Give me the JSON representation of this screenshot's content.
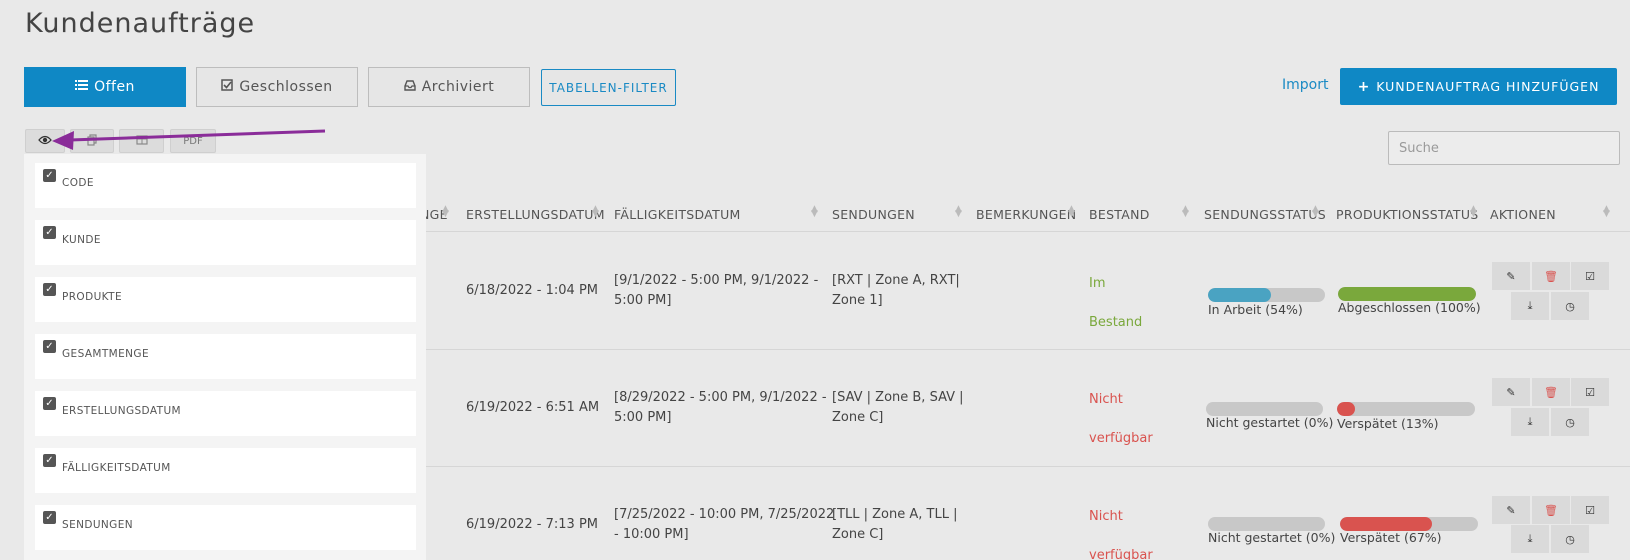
{
  "page": {
    "title": "Kundenaufträge"
  },
  "tabs": [
    {
      "label": "Offen",
      "icon": "list-icon",
      "active": true
    },
    {
      "label": "Geschlossen",
      "icon": "check-square-icon"
    },
    {
      "label": "Archiviert",
      "icon": "inbox-icon"
    }
  ],
  "filter_button": "TABELLEN-FILTER",
  "import_link": "Import",
  "add_button": "KUNDENAUFTRAG HINZUFÜGEN",
  "toolbar": {
    "pdf_label": "PDF"
  },
  "search": {
    "placeholder": "Suche"
  },
  "columns": {
    "gesamtmenge_partial": "NGE",
    "erstellungsdatum": "ERSTELLUNGSDATUM",
    "faelligkeitsdatum": "FÄLLIGKEITSDATUM",
    "sendungen": "SENDUNGEN",
    "bemerkungen": "BEMERKUNGEN",
    "bestand": "BESTAND",
    "sendungsstatus": "SENDUNGSSTATUS",
    "produktionsstatus": "PRODUKTIONSSTATUS",
    "aktionen": "AKTIONEN"
  },
  "rows": [
    {
      "created": "6/18/2022 - 1:04 PM",
      "due_1": "[9/1/2022 - 5:00 PM, 9/1/2022 -",
      "due_2": "5:00 PM]",
      "ship_1": "[RXT | Zone A, RXT|",
      "ship_2": "Zone 1]",
      "stock_1": "Im",
      "stock_2": "Bestand",
      "stock_ok": true,
      "shipping_label": "In Arbeit (54%)",
      "shipping_pct": 54,
      "shipping_color": "#4aa3c2",
      "production_label": "Abgeschlossen (100%)",
      "production_pct": 100,
      "production_color": "#7aa83c"
    },
    {
      "created": "6/19/2022 - 6:51 AM",
      "due_1": "[8/29/2022 - 5:00 PM, 9/1/2022 -",
      "due_2": "5:00 PM]",
      "ship_1": "[SAV | Zone B, SAV |",
      "ship_2": "Zone C]",
      "stock_1": "Nicht",
      "stock_2": "verfügbar",
      "stock_ok": false,
      "shipping_label": "Nicht gestartet (0%)",
      "shipping_pct": 0,
      "shipping_color": "#c8c8c8",
      "production_label": "Verspätet (13%)",
      "production_pct": 13,
      "production_color": "#d9534f"
    },
    {
      "created": "6/19/2022 - 7:13 PM",
      "due_1": "[7/25/2022 - 10:00 PM, 7/25/2022",
      "due_2": "- 10:00 PM]",
      "ship_1": "[TLL | Zone A, TLL |",
      "ship_2": "Zone C]",
      "stock_1": "Nicht",
      "stock_2": "verfügbar",
      "stock_ok": false,
      "shipping_label": "Nicht gestartet (0%)",
      "shipping_pct": 0,
      "shipping_color": "#c8c8c8",
      "production_label": "Verspätet (67%)",
      "production_pct": 67,
      "production_color": "#d9534f"
    }
  ],
  "column_picker": [
    {
      "label": "CODE",
      "checked": true
    },
    {
      "label": "KUNDE",
      "checked": true
    },
    {
      "label": "PRODUKTE",
      "checked": true
    },
    {
      "label": "GESAMTMENGE",
      "checked": true
    },
    {
      "label": "ERSTELLUNGSDATUM",
      "checked": true
    },
    {
      "label": "FÄLLIGKEITSDATUM",
      "checked": true
    },
    {
      "label": "SENDUNGEN",
      "checked": true
    }
  ],
  "colors": {
    "primary": "#0f88c5",
    "success": "#7aa83c",
    "danger": "#d9534f",
    "info": "#4aa3c2",
    "annotation_arrow": "#8a2c99"
  }
}
